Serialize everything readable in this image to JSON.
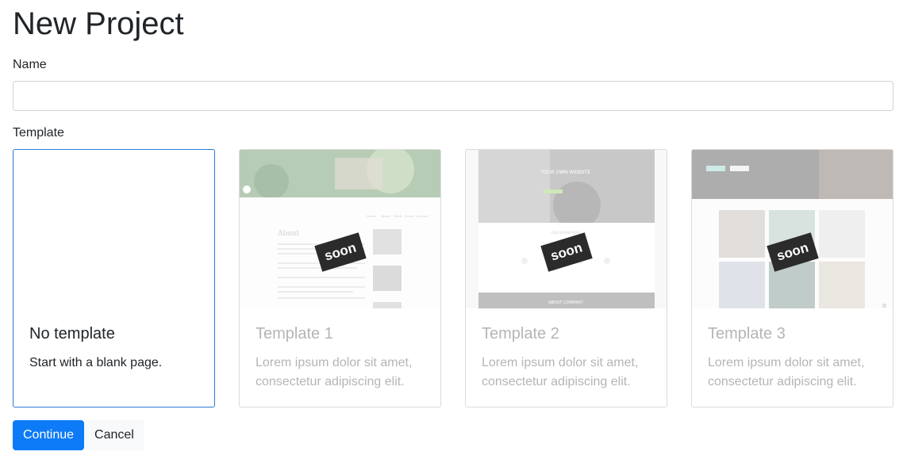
{
  "page": {
    "title": "New Project",
    "name_label": "Name",
    "name_value": "",
    "template_label": "Template"
  },
  "templates": [
    {
      "title": "No template",
      "desc": "Start with a blank page."
    },
    {
      "title": "Template 1",
      "desc": "Lorem ipsum dolor sit amet, consectetur adipiscing elit.",
      "badge": "soon",
      "preview": {
        "nav": [
          "Home",
          "About",
          "Work",
          "News",
          "Contact"
        ],
        "heading": "About"
      }
    },
    {
      "title": "Template 2",
      "desc": "Lorem ipsum dolor sit amet, consectetur adipiscing elit.",
      "badge": "soon",
      "preview": {
        "hero": "YOUR OWN WEBSITE",
        "section": "OUR ADVANTAGES",
        "footer": "ABOUT COMPANY"
      }
    },
    {
      "title": "Template 3",
      "desc": "Lorem ipsum dolor sit amet, consectetur adipiscing elit.",
      "badge": "soon"
    }
  ],
  "buttons": {
    "continue": "Continue",
    "cancel": "Cancel"
  },
  "colors": {
    "primary": "#0d7bf7",
    "selected_border": "#2b7ad8",
    "muted_text": "#b5b5b5"
  }
}
